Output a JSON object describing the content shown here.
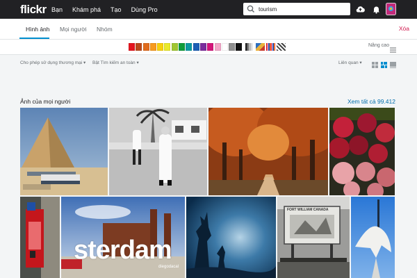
{
  "topbar": {
    "logo": "flickr",
    "nav": [
      "Bạn",
      "Khám phá",
      "Tạo",
      "Dùng Pro"
    ],
    "search_value": "tourism",
    "icons": [
      "cloud-upload-icon",
      "bell-icon",
      "avatar-icon"
    ]
  },
  "subnav": {
    "tabs": [
      "Hình ảnh",
      "Mọi người",
      "Nhóm"
    ],
    "active_tab": "Hình ảnh",
    "clear_label": "Xóa"
  },
  "color_filter": {
    "swatches": [
      "#e4161f",
      "#bb4a1c",
      "#e06c1e",
      "#f79a1d",
      "#f7d00c",
      "#e9e92b",
      "#a0c632",
      "#109c3a",
      "#0d9aa1",
      "#1d5fb6",
      "#7a2d9c",
      "#d3157a",
      "#f2a5c8",
      "#ffffff",
      "#8f8f8f",
      "#111111"
    ],
    "advanced_label": "Nâng cao"
  },
  "filters": {
    "license": "Cho phép sử dụng thương mại",
    "safe_search": "Bật Tìm kiếm an toàn",
    "sort": "Liên quan"
  },
  "section": {
    "title": "Ảnh của mọi người",
    "see_all": "Xem tất cả 99.412"
  },
  "photos": {
    "amsterdam_text": "sterdam",
    "amsterdam_credit": "diegodacal",
    "sign_text": "FORT WILLIAM CANADA"
  }
}
